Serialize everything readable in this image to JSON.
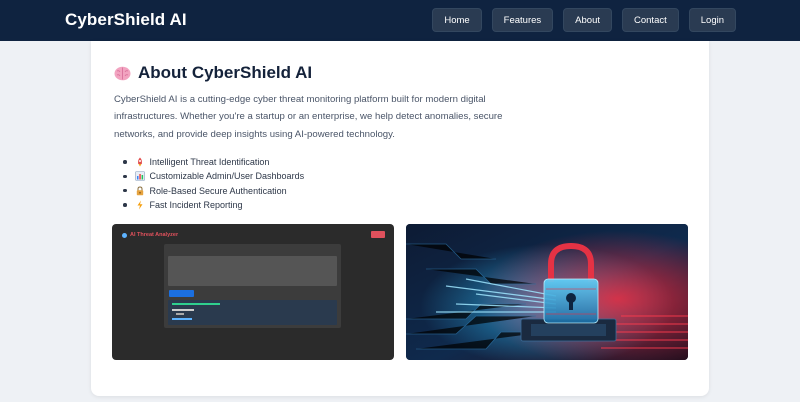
{
  "brand": "CyberShield AI",
  "nav": [
    "Home",
    "Features",
    "About",
    "Contact",
    "Login"
  ],
  "about": {
    "title": "About CyberShield AI",
    "description": "CyberShield AI is a cutting-edge cyber threat monitoring platform built for modern digital infrastructures. Whether you're a startup or an enterprise, we help detect anomalies, secure networks, and provide deep insights using AI-powered technology.",
    "features": [
      {
        "icon": "rocket-icon",
        "label": "Intelligent Threat Identification"
      },
      {
        "icon": "chart-icon",
        "label": "Customizable Admin/User Dashboards"
      },
      {
        "icon": "lock-icon",
        "label": "Role-Based Secure Authentication"
      },
      {
        "icon": "lightning-icon",
        "label": "Fast Incident Reporting"
      }
    ]
  },
  "screenshot_app": {
    "title": "AI Threat Analyzer"
  },
  "colors": {
    "navbar": "#0f2340",
    "accent_red": "#e0515c",
    "accent_blue": "#1b6fe0"
  }
}
